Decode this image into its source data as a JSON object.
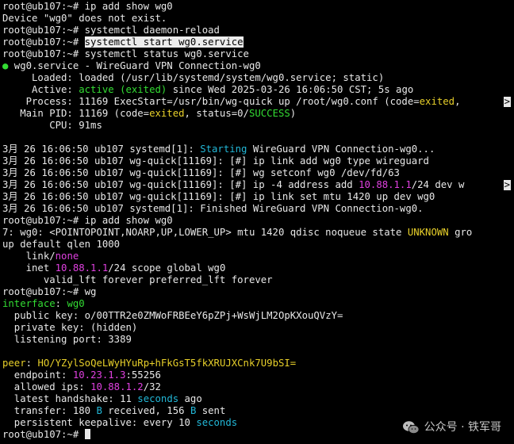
{
  "terminal": {
    "lines": [
      "root@ub107:~# ip add show wg0",
      "Device \"wg0\" does not exist.",
      "root@ub107:~# systemctl daemon-reload",
      "root@ub107:~# ",
      "systemctl start wg0.service",
      "root@ub107:~# systemctl status wg0.service",
      "●",
      " wg0.service - WireGuard VPN Connection-wg0",
      "     Loaded: loaded (/usr/lib/systemd/system/wg0.service; static)",
      "     Active: ",
      "active (exited)",
      " since Wed 2025-03-26 16:06:50 CST; 5s ago",
      "    Process: 11169 ExecStart=/usr/bin/wg-quick up /root/wg0.conf (code=",
      "exited",
      ", ",
      ">",
      "   Main PID: 11169 (code=",
      "exited",
      ", status=0/",
      "SUCCESS",
      ")",
      "        CPU: 91ms",
      "3月 26 16:06:50 ub107 systemd[1]: ",
      "Starting",
      " WireGuard VPN Connection-wg0...",
      "3月 26 16:06:50 ub107 wg-quick[11169]: [#] ip link add wg0 type wireguard",
      "3月 26 16:06:50 ub107 wg-quick[11169]: [#] wg setconf wg0 /dev/fd/63",
      "3月 26 16:06:50 ub107 wg-quick[11169]: [#] ip -4 address add ",
      "10.88.1.1",
      "/24 dev w",
      "3月 26 16:06:50 ub107 wg-quick[11169]: [#] ip link set mtu 1420 up dev wg0",
      "3月 26 16:06:50 ub107 systemd[1]: Finished WireGuard VPN Connection-wg0.",
      "root@ub107:~# ip add show wg0",
      "7: wg0: <POINTOPOINT,NOARP,UP,LOWER_UP> mtu 1420 qdisc noqueue state ",
      "UNKNOWN",
      " gro",
      "up default qlen 1000",
      "    link/",
      "none",
      "    inet ",
      "10.88.1.1",
      "/24 scope global wg0",
      "       valid_lft forever preferred_lft forever",
      "root@ub107:~# wg",
      "interface",
      ": ",
      "wg0",
      "  public key",
      ": o/00TTR2e0ZMWoFRBEeY6pZPj+WsWjLM2OpKXouQVzY=",
      "  private key",
      ": (hidden)",
      "  listening port",
      ": 3389",
      "peer",
      ": ",
      "HO/YZylSoQeLWyHYuRp+hFkGsT5fkXRUJXCnk7U9bSI=",
      "  endpoint",
      ": ",
      "10.23.1.3",
      ":55256",
      "  allowed ips",
      ": ",
      "10.88.1.2",
      "/32",
      "  latest handshake",
      ": 11 ",
      "seconds",
      " ago",
      "  transfer",
      ": 180 ",
      "B",
      " received, 156 ",
      "B",
      " sent",
      "  persistent keepalive",
      ": every 10 ",
      "seconds",
      "root@ub107:~# "
    ]
  },
  "watermark": {
    "text": "公众号 · 铁军哥",
    "icon": "wechat-icon"
  },
  "colors": {
    "background": "#000000",
    "foreground": "#e8e8e8",
    "green": "#33dd33",
    "cyan": "#22b8d8",
    "yellow": "#e8d02a",
    "magenta": "#e040e0"
  }
}
